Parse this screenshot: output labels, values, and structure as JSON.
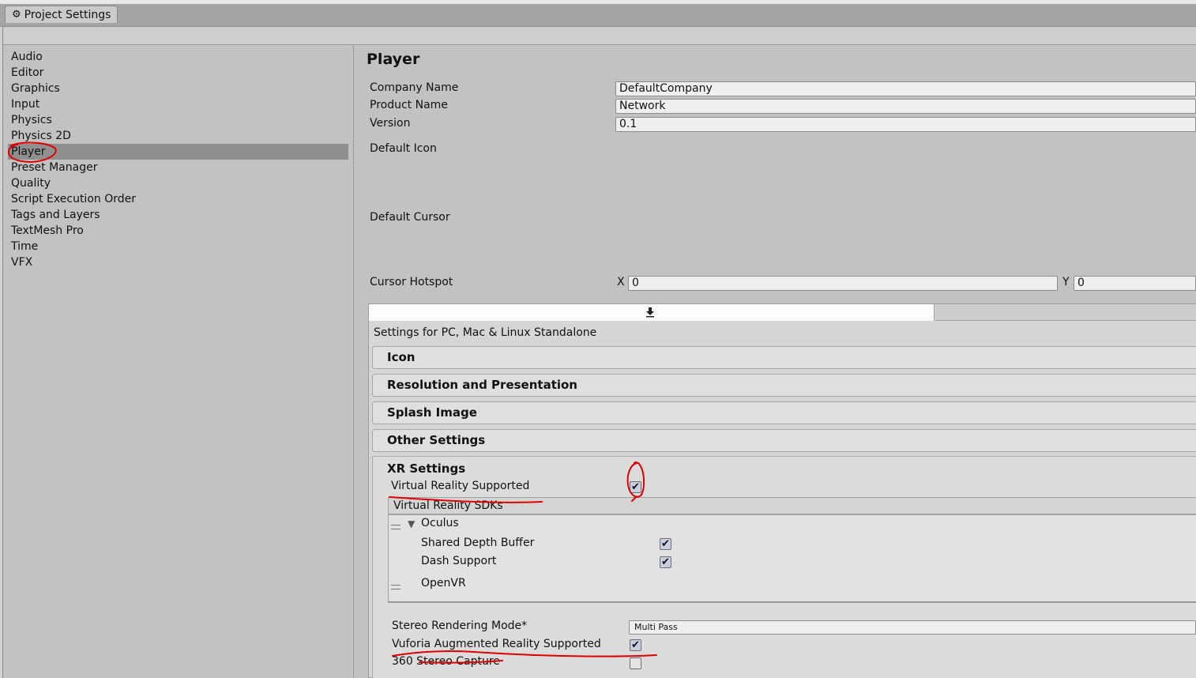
{
  "window": {
    "tab_label": "Project Settings",
    "tab_icon": "gear-icon"
  },
  "sidebar": {
    "items": [
      {
        "label": "Audio"
      },
      {
        "label": "Editor"
      },
      {
        "label": "Graphics"
      },
      {
        "label": "Input"
      },
      {
        "label": "Physics"
      },
      {
        "label": "Physics 2D"
      },
      {
        "label": "Player",
        "selected": true
      },
      {
        "label": "Preset Manager"
      },
      {
        "label": "Quality"
      },
      {
        "label": "Script Execution Order"
      },
      {
        "label": "Tags and Layers"
      },
      {
        "label": "TextMesh Pro"
      },
      {
        "label": "Time"
      },
      {
        "label": "VFX"
      }
    ]
  },
  "player": {
    "title": "Player",
    "company_name_label": "Company Name",
    "company_name_value": "DefaultCompany",
    "product_name_label": "Product Name",
    "product_name_value": "Network",
    "version_label": "Version",
    "version_value": "0.1",
    "default_icon_label": "Default Icon",
    "default_cursor_label": "Default Cursor",
    "cursor_hotspot_label": "Cursor Hotspot",
    "hotspot_x_label": "X",
    "hotspot_x_value": "0",
    "hotspot_y_label": "Y",
    "hotspot_y_value": "0"
  },
  "platform": {
    "settings_for": "Settings for PC, Mac & Linux Standalone",
    "active_tab_icon": "download-icon",
    "sections": {
      "icon": "Icon",
      "resolution": "Resolution and Presentation",
      "splash": "Splash Image",
      "other": "Other Settings",
      "xr": "XR Settings"
    }
  },
  "xr": {
    "vr_supported_label": "Virtual Reality Supported",
    "vr_supported": true,
    "vr_sdks_label": "Virtual Reality SDKs",
    "sdks": {
      "oculus": {
        "name": "Oculus",
        "shared_depth_label": "Shared Depth Buffer",
        "shared_depth": true,
        "dash_label": "Dash Support",
        "dash": true
      },
      "openvr": {
        "name": "OpenVR"
      }
    },
    "stereo_mode_label": "Stereo Rendering Mode*",
    "stereo_mode_value": "Multi Pass",
    "vuforia_label": "Vuforia Augmented Reality Supported",
    "vuforia": true,
    "stereo360_label": "360 Stereo Capture",
    "stereo360": false
  },
  "annotations": {
    "color": "#e00000"
  },
  "colors": {
    "selected_bg": "#8f8f8f",
    "panel_bg": "#c2c2c2"
  }
}
